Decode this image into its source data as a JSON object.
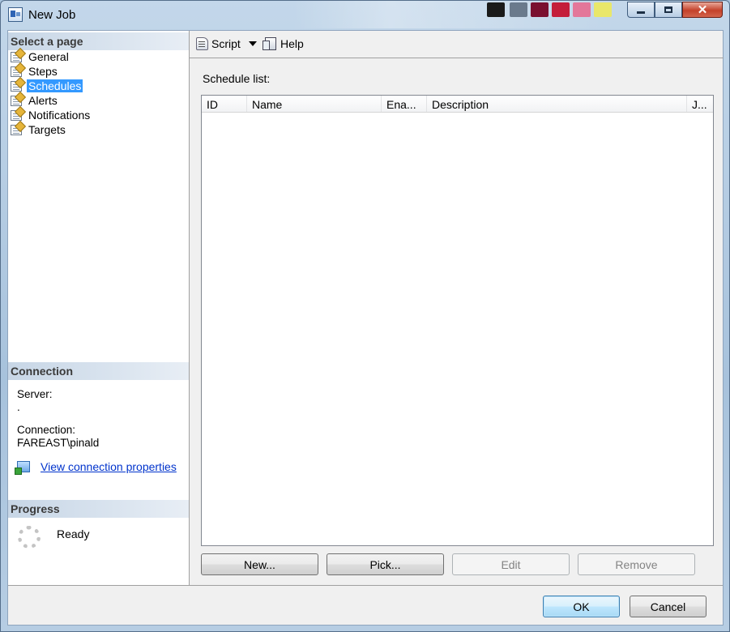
{
  "window": {
    "title": "New Job",
    "colors": {
      "selection": "#3399ff",
      "link": "#0033cc",
      "close_button": "#c4412a"
    }
  },
  "left_pane": {
    "select_page_header": "Select a page",
    "pages": [
      {
        "label": "General",
        "selected": false
      },
      {
        "label": "Steps",
        "selected": false
      },
      {
        "label": "Schedules",
        "selected": true
      },
      {
        "label": "Alerts",
        "selected": false
      },
      {
        "label": "Notifications",
        "selected": false
      },
      {
        "label": "Targets",
        "selected": false
      }
    ],
    "connection": {
      "header": "Connection",
      "server_label": "Server:",
      "server_value": ".",
      "connection_label": "Connection:",
      "connection_value": "FAREAST\\pinald",
      "view_properties_link": "View connection properties"
    },
    "progress": {
      "header": "Progress",
      "status": "Ready"
    }
  },
  "toolbar": {
    "script_label": "Script",
    "help_label": "Help"
  },
  "main": {
    "schedule_list_label": "Schedule list:",
    "columns": [
      "ID",
      "Name",
      "Ena...",
      "Description",
      "J..."
    ],
    "rows": [],
    "buttons": {
      "new": "New...",
      "pick": "Pick...",
      "edit": "Edit",
      "remove": "Remove"
    }
  },
  "footer": {
    "ok": "OK",
    "cancel": "Cancel"
  }
}
